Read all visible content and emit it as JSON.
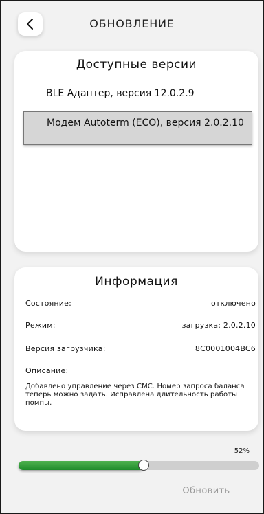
{
  "header": {
    "title": "ОБНОВЛЕНИЕ",
    "back_icon": "chevron-left-icon"
  },
  "versions": {
    "title": "Доступные версии",
    "items": [
      {
        "label": "BLE Адаптер, версия 12.0.2.9",
        "selected": false
      },
      {
        "label": "Модем Autoterm (ECO), версия 2.0.2.10",
        "selected": true
      }
    ]
  },
  "info": {
    "title": "Информация",
    "rows": [
      {
        "label": "Состояние:",
        "value": "отключено"
      },
      {
        "label": "Режим:",
        "value": "загрузка: 2.0.2.10"
      },
      {
        "label": "Версия загрузчика:",
        "value": "8C0001004BC6"
      }
    ],
    "description_label": "Описание:",
    "description": "Добавлено управление через СМС. Номер запроса баланса теперь можно задать. Исправлена длительность работы помпы."
  },
  "progress": {
    "percent_label": "52%",
    "value": 0.52,
    "color": "#2a9a36"
  },
  "update_button": {
    "label": "Обновить",
    "enabled": false
  }
}
